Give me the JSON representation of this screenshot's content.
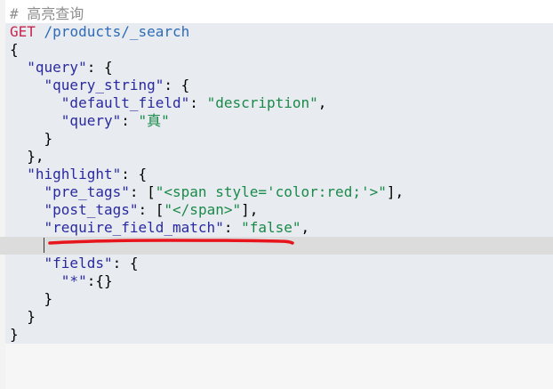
{
  "editor": {
    "lines": [
      {
        "segments": [
          {
            "cls": "comment",
            "text": "# 高亮查询"
          }
        ]
      },
      {
        "segments": [
          {
            "cls": "method",
            "text": "GET"
          },
          {
            "cls": "url",
            "text": " /products/_search"
          }
        ]
      },
      {
        "segments": [
          {
            "cls": "punc",
            "text": "{"
          }
        ]
      },
      {
        "segments": [
          {
            "cls": "punc",
            "text": "  "
          },
          {
            "cls": "key",
            "text": "\"query\""
          },
          {
            "cls": "punc",
            "text": ": {"
          }
        ]
      },
      {
        "segments": [
          {
            "cls": "punc",
            "text": "    "
          },
          {
            "cls": "key",
            "text": "\"query_string\""
          },
          {
            "cls": "punc",
            "text": ": {"
          }
        ]
      },
      {
        "segments": [
          {
            "cls": "punc",
            "text": "      "
          },
          {
            "cls": "key",
            "text": "\"default_field\""
          },
          {
            "cls": "punc",
            "text": ": "
          },
          {
            "cls": "str",
            "text": "\"description\""
          },
          {
            "cls": "punc",
            "text": ","
          }
        ]
      },
      {
        "segments": [
          {
            "cls": "punc",
            "text": "      "
          },
          {
            "cls": "key",
            "text": "\"query\""
          },
          {
            "cls": "punc",
            "text": ": "
          },
          {
            "cls": "str",
            "text": "\"真\""
          }
        ]
      },
      {
        "segments": [
          {
            "cls": "punc",
            "text": "    }"
          }
        ]
      },
      {
        "segments": [
          {
            "cls": "punc",
            "text": "  },"
          }
        ]
      },
      {
        "segments": [
          {
            "cls": "punc",
            "text": "  "
          },
          {
            "cls": "key",
            "text": "\"highlight\""
          },
          {
            "cls": "punc",
            "text": ": {"
          }
        ]
      },
      {
        "segments": [
          {
            "cls": "punc",
            "text": "    "
          },
          {
            "cls": "key",
            "text": "\"pre_tags\""
          },
          {
            "cls": "punc",
            "text": ": ["
          },
          {
            "cls": "str",
            "text": "\"<span style='color:red;'>\""
          },
          {
            "cls": "punc",
            "text": "],"
          }
        ]
      },
      {
        "segments": [
          {
            "cls": "punc",
            "text": "    "
          },
          {
            "cls": "key",
            "text": "\"post_tags\""
          },
          {
            "cls": "punc",
            "text": ": ["
          },
          {
            "cls": "str",
            "text": "\"</span>\""
          },
          {
            "cls": "punc",
            "text": "],"
          }
        ]
      },
      {
        "segments": [
          {
            "cls": "punc",
            "text": "    "
          },
          {
            "cls": "key",
            "text": "\"require_field_match\""
          },
          {
            "cls": "punc",
            "text": ": "
          },
          {
            "cls": "str",
            "text": "\"false\""
          },
          {
            "cls": "punc",
            "text": ","
          }
        ]
      },
      {
        "segments": [
          {
            "cls": "punc",
            "text": "    "
          }
        ]
      },
      {
        "segments": [
          {
            "cls": "punc",
            "text": "    "
          },
          {
            "cls": "key",
            "text": "\"fields\""
          },
          {
            "cls": "punc",
            "text": ": {"
          }
        ]
      },
      {
        "segments": [
          {
            "cls": "punc",
            "text": "      "
          },
          {
            "cls": "key",
            "text": "\"*\""
          },
          {
            "cls": "punc",
            "text": ":{}"
          }
        ]
      },
      {
        "segments": [
          {
            "cls": "punc",
            "text": "    }"
          }
        ]
      },
      {
        "segments": [
          {
            "cls": "punc",
            "text": "  }"
          }
        ]
      },
      {
        "segments": [
          {
            "cls": "punc",
            "text": "}"
          }
        ]
      }
    ],
    "annotation_color": "#e8141c"
  }
}
